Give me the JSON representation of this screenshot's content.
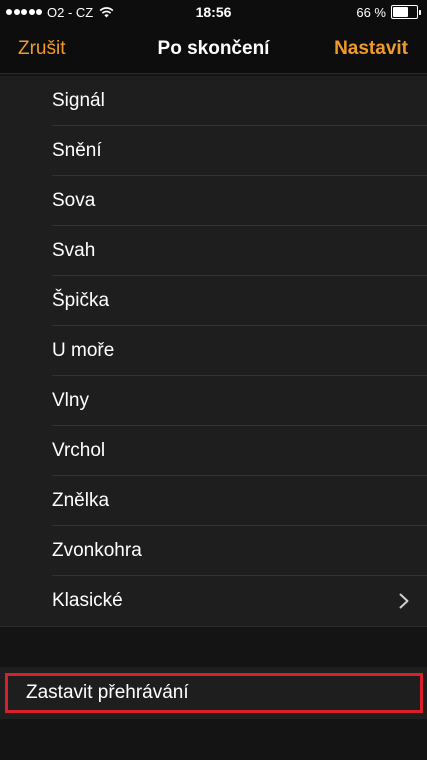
{
  "status_bar": {
    "carrier": "O2 - CZ",
    "time": "18:56",
    "battery_percent": "66 %",
    "battery_level": 0.66,
    "signal_bars_filled": 5
  },
  "nav": {
    "cancel_label": "Zrušit",
    "title": "Po skončení",
    "set_label": "Nastavit",
    "accent_color": "#f09a2a"
  },
  "tones": [
    "Signál",
    "Snění",
    "Sova",
    "Svah",
    "Špička",
    "U moře",
    "Vlny",
    "Vrchol",
    "Znělka",
    "Zvonkohra",
    "Klasické"
  ],
  "stop_playback_label": "Zastavit přehrávání",
  "icons": {
    "classic_row": "chevron-right-icon",
    "status": [
      "signal-icon",
      "wifi-icon",
      "battery-icon"
    ]
  },
  "highlight_color": "#d8202a"
}
